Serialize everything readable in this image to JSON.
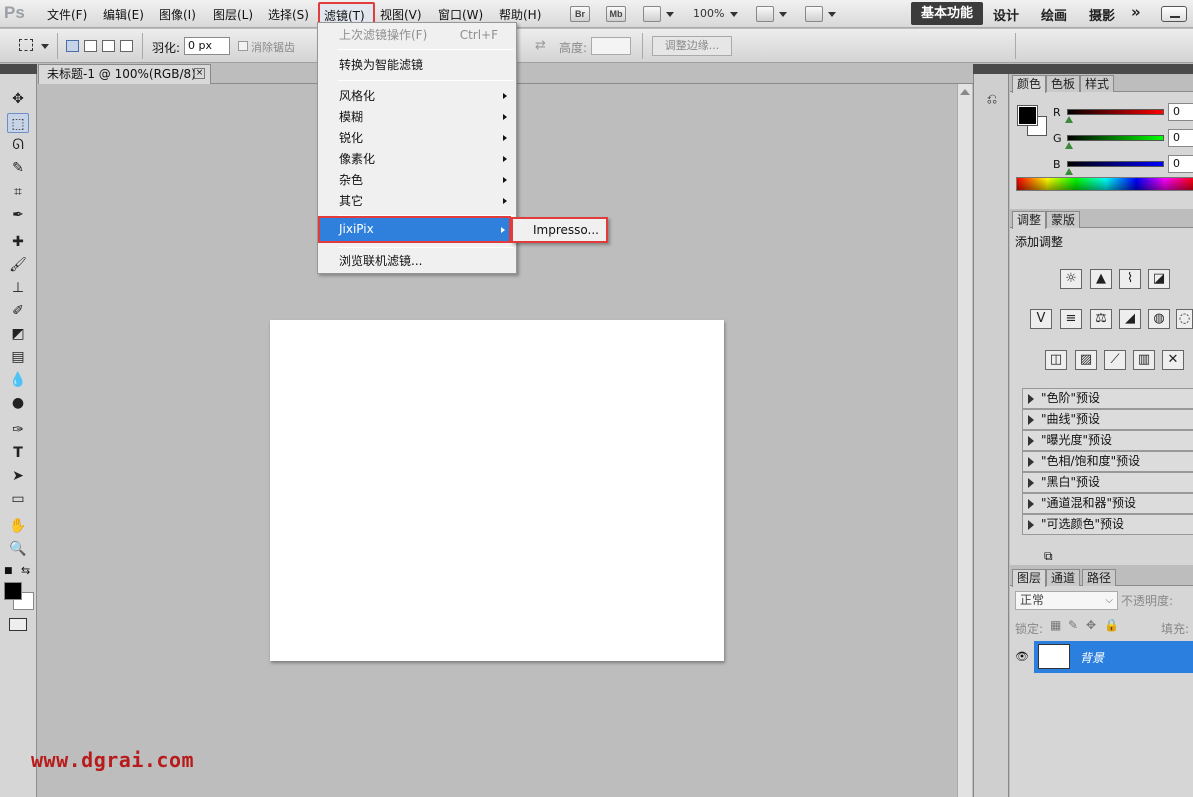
{
  "app": {
    "logo": "Ps"
  },
  "menubar": {
    "items": [
      "文件(F)",
      "编辑(E)",
      "图像(I)",
      "图层(L)",
      "选择(S)",
      "滤镜(T)",
      "视图(V)",
      "窗口(W)",
      "帮助(H)"
    ],
    "bridge": "Br",
    "minibridge": "Mb",
    "zoom": "100%",
    "workspaces": [
      "基本功能",
      "设计",
      "绘画",
      "摄影"
    ],
    "more": "»"
  },
  "options": {
    "feather_label": "羽化:",
    "feather_value": "0 px",
    "antialias_label": "消除锯齿",
    "height_label": "高度:",
    "refine_edge": "调整边缘..."
  },
  "document": {
    "tab_title": "未标题-1 @ 100%(RGB/8)",
    "close": "×"
  },
  "filter_menu": {
    "last_filter": "上次滤镜操作(F)",
    "last_filter_shortcut": "Ctrl+F",
    "convert_smart": "转换为智能滤镜",
    "groups": [
      "风格化",
      "模糊",
      "锐化",
      "像素化",
      "杂色",
      "其它"
    ],
    "jixipix": "JixiPix",
    "browse_online": "浏览联机滤镜...",
    "submenu_item": "Impresso..."
  },
  "color_panel": {
    "tabs": [
      "颜色",
      "色板",
      "样式"
    ],
    "channels": [
      {
        "label": "R",
        "value": "0"
      },
      {
        "label": "G",
        "value": "0"
      },
      {
        "label": "B",
        "value": "0"
      }
    ]
  },
  "adjust_panel": {
    "tabs": [
      "调整",
      "蒙版"
    ],
    "heading": "添加调整",
    "presets": [
      "\"色阶\"预设",
      "\"曲线\"预设",
      "\"曝光度\"预设",
      "\"色相/饱和度\"预设",
      "\"黑白\"预设",
      "\"通道混和器\"预设",
      "\"可选颜色\"预设"
    ]
  },
  "layers_panel": {
    "tabs": [
      "图层",
      "通道",
      "路径"
    ],
    "blend_mode": "正常",
    "opacity_label": "不透明度:",
    "lock_label": "锁定:",
    "fill_label": "填充:",
    "layer_name": "背景"
  },
  "watermark": "www.dgrai.com"
}
